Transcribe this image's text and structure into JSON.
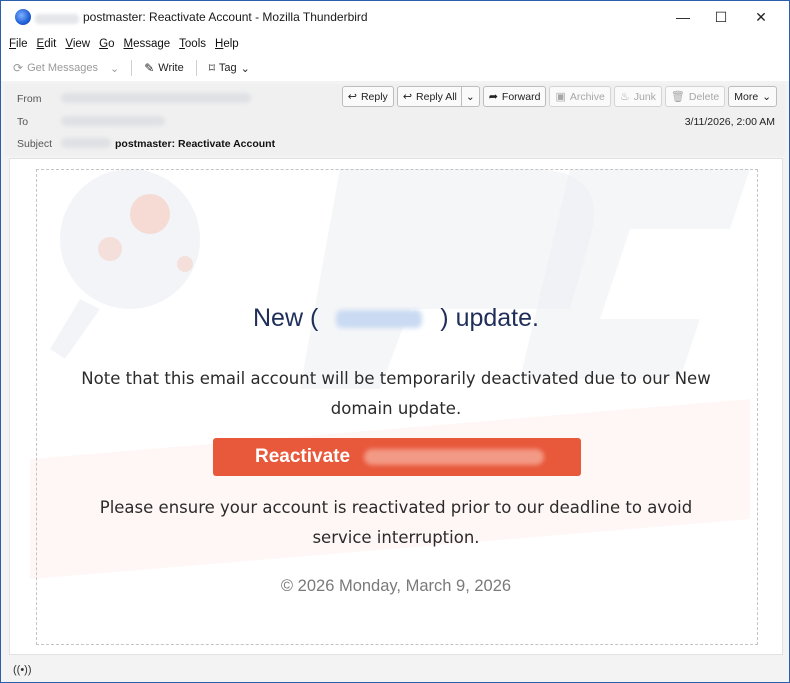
{
  "window": {
    "title": "postmaster: Reactivate Account - Mozilla Thunderbird",
    "minimize_glyph": "—",
    "maximize_glyph": "☐",
    "close_glyph": "✕"
  },
  "menu": [
    {
      "u": "F",
      "rest": "ile"
    },
    {
      "u": "E",
      "rest": "dit"
    },
    {
      "u": "V",
      "rest": "iew"
    },
    {
      "u": "G",
      "rest": "o"
    },
    {
      "u": "M",
      "rest": "essage"
    },
    {
      "u": "T",
      "rest": "ools"
    },
    {
      "u": "H",
      "rest": "elp"
    }
  ],
  "toolbar": {
    "get_messages": "Get Messages",
    "write": "Write",
    "tag": "Tag"
  },
  "header": {
    "from_label": "From",
    "to_label": "To",
    "subject_label": "Subject",
    "subject": "postmaster: Reactivate Account",
    "date": "3/11/2026, 2:00 AM",
    "actions": {
      "reply": "Reply",
      "reply_all": "Reply All",
      "forward": "Forward",
      "archive": "Archive",
      "junk": "Junk",
      "delete": "Delete",
      "more": "More"
    }
  },
  "email": {
    "headline_prefix": "New (",
    "headline_suffix": ") update.",
    "paragraph1": "Note that this email account will be temporarily deactivated due to our New domain update.",
    "button_label": "Reactivate",
    "paragraph2": "Please ensure your account is reactivated prior to our deadline to avoid service interruption.",
    "footer": "© 2026 Monday, March 9, 2026"
  },
  "colors": {
    "button": "#e8583b",
    "headline": "#1f2f5a",
    "window_border": "#2b5fab"
  }
}
